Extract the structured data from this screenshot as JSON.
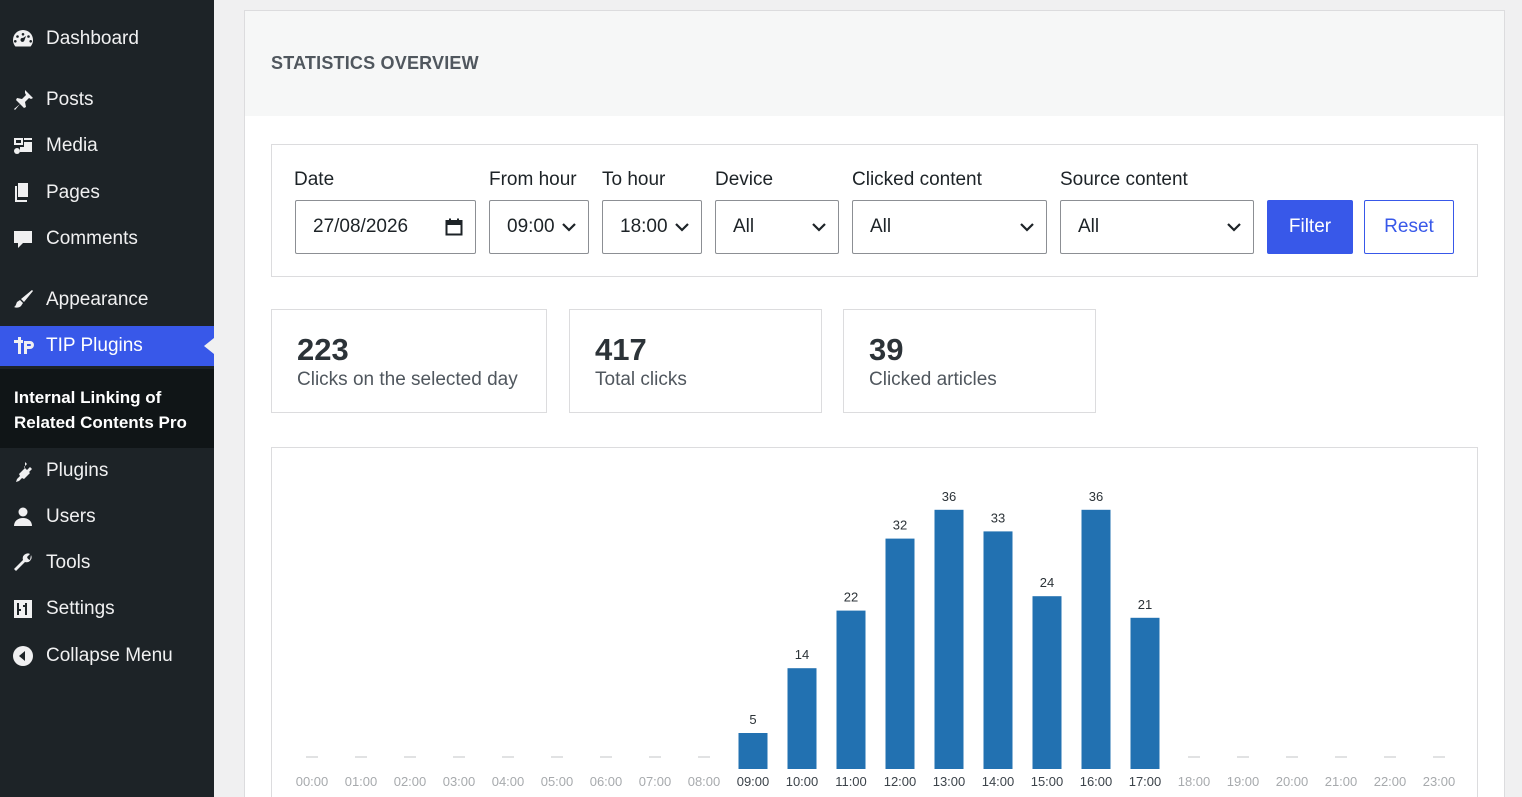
{
  "sidebar": {
    "items": [
      {
        "label": "Dashboard",
        "icon": "dashboard-icon"
      },
      {
        "label": "Posts",
        "icon": "pin-icon"
      },
      {
        "label": "Media",
        "icon": "media-icon"
      },
      {
        "label": "Pages",
        "icon": "pages-icon"
      },
      {
        "label": "Comments",
        "icon": "comment-icon"
      },
      {
        "label": "Appearance",
        "icon": "brush-icon"
      },
      {
        "label": "TIP Plugins",
        "icon": "tip-logo-icon",
        "active": true
      },
      {
        "label": "Plugins",
        "icon": "plugin-icon"
      },
      {
        "label": "Users",
        "icon": "user-icon"
      },
      {
        "label": "Tools",
        "icon": "wrench-icon"
      },
      {
        "label": "Settings",
        "icon": "sliders-icon"
      },
      {
        "label": "Collapse Menu",
        "icon": "collapse-icon"
      }
    ],
    "submenu_label": "Internal Linking of Related Contents Pro"
  },
  "page": {
    "title": "STATISTICS OVERVIEW"
  },
  "filters": {
    "date_label": "Date",
    "date_value": "27/08/2026",
    "from_hour_label": "From hour",
    "from_hour_value": "09:00",
    "to_hour_label": "To hour",
    "to_hour_value": "18:00",
    "device_label": "Device",
    "device_value": "All",
    "clicked_label": "Clicked content",
    "clicked_value": "All",
    "source_label": "Source content",
    "source_value": "All",
    "filter_button": "Filter",
    "reset_button": "Reset"
  },
  "stats": [
    {
      "value": "223",
      "label": "Clicks on the selected day"
    },
    {
      "value": "417",
      "label": "Total clicks"
    },
    {
      "value": "39",
      "label": "Clicked articles"
    }
  ],
  "colors": {
    "accent": "#3858e9",
    "bar": "#2271b1",
    "sidebar_bg": "#1d2327"
  },
  "chart_data": {
    "type": "bar",
    "categories": [
      "00:00",
      "01:00",
      "02:00",
      "03:00",
      "04:00",
      "05:00",
      "06:00",
      "07:00",
      "08:00",
      "09:00",
      "10:00",
      "11:00",
      "12:00",
      "13:00",
      "14:00",
      "15:00",
      "16:00",
      "17:00",
      "18:00",
      "19:00",
      "20:00",
      "21:00",
      "22:00",
      "23:00"
    ],
    "values": [
      0,
      0,
      0,
      0,
      0,
      0,
      0,
      0,
      0,
      5,
      14,
      22,
      32,
      36,
      33,
      24,
      36,
      21,
      0,
      0,
      0,
      0,
      0,
      0
    ],
    "active_range": [
      "09:00",
      "17:00"
    ],
    "ylim": [
      0,
      40
    ],
    "grid": false
  }
}
